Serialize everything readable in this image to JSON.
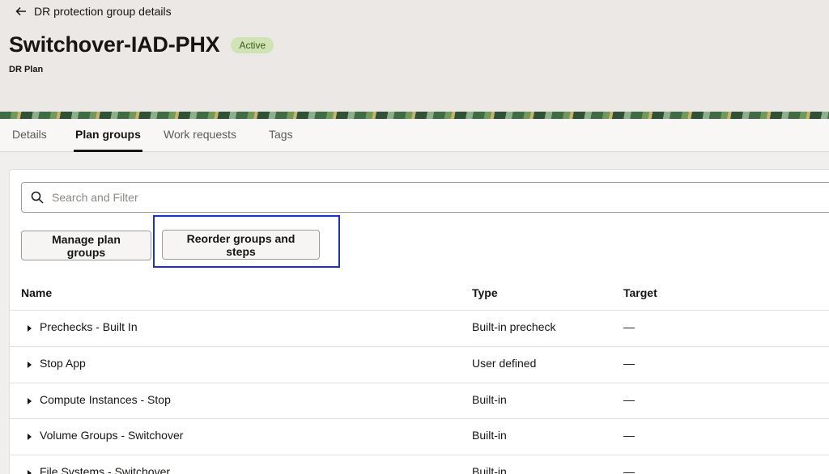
{
  "header": {
    "back_label": "DR protection group details",
    "title": "Switchover-IAD-PHX",
    "status": "Active",
    "subtitle": "DR Plan"
  },
  "tabs": [
    {
      "label": "Details"
    },
    {
      "label": "Plan groups"
    },
    {
      "label": "Work requests"
    },
    {
      "label": "Tags"
    }
  ],
  "search": {
    "placeholder": "Search and Filter"
  },
  "toolbar": {
    "manage_label": "Manage plan groups",
    "reorder_label": "Reorder groups and steps"
  },
  "table": {
    "columns": [
      "Name",
      "Type",
      "Target"
    ],
    "rows": [
      {
        "name": "Prechecks - Built In",
        "type": "Built-in precheck",
        "target": "—"
      },
      {
        "name": "Stop App",
        "type": "User defined",
        "target": "—"
      },
      {
        "name": "Compute Instances - Stop",
        "type": "Built-in",
        "target": "—"
      },
      {
        "name": "Volume Groups - Switchover",
        "type": "Built-in",
        "target": "—"
      },
      {
        "name": "File Systems - Switchover",
        "type": "Built-in",
        "target": "—"
      }
    ]
  },
  "colors": {
    "highlight": "#1b2fd6",
    "badge_bg": "#cfe3b5"
  }
}
